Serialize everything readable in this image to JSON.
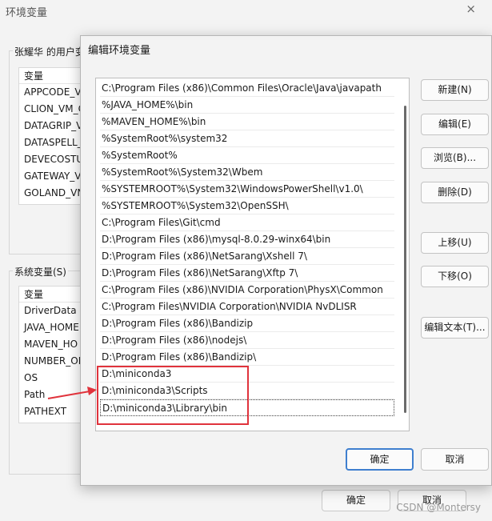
{
  "background_window": {
    "title": "环境变量",
    "close_glyph": "×",
    "user_group_label": "张耀华 的用户变",
    "user_vars_header": "变量",
    "user_vars": [
      "APPCODE_VI",
      "CLION_VM_C",
      "DATAGRIP_V",
      "DATASPELL_",
      "DEVECOSTU",
      "GATEWAY_V",
      "GOLAND_VN"
    ],
    "system_group_label": "系统变量(S)",
    "system_vars_header": "变量",
    "system_vars": [
      "DriverData",
      "JAVA_HOME",
      "MAVEN_HO",
      "NUMBER_OI",
      "OS",
      "Path",
      "PATHEXT"
    ],
    "ok_label": "确定",
    "cancel_label": "取消"
  },
  "dialog": {
    "title": "编辑环境变量",
    "paths": [
      "C:\\Program Files (x86)\\Common Files\\Oracle\\Java\\javapath",
      "%JAVA_HOME%\\bin",
      "%MAVEN_HOME%\\bin",
      "%SystemRoot%\\system32",
      "%SystemRoot%",
      "%SystemRoot%\\System32\\Wbem",
      "%SYSTEMROOT%\\System32\\WindowsPowerShell\\v1.0\\",
      "%SYSTEMROOT%\\System32\\OpenSSH\\",
      "C:\\Program Files\\Git\\cmd",
      "D:\\Program Files (x86)\\mysql-8.0.29-winx64\\bin",
      "D:\\Program Files (x86)\\NetSarang\\Xshell 7\\",
      "D:\\Program Files (x86)\\NetSarang\\Xftp 7\\",
      "C:\\Program Files (x86)\\NVIDIA Corporation\\PhysX\\Common",
      "C:\\Program Files\\NVIDIA Corporation\\NVIDIA NvDLISR",
      "D:\\Program Files (x86)\\Bandizip",
      "D:\\Program Files (x86)\\nodejs\\",
      "D:\\Program Files (x86)\\Bandizip\\",
      "D:\\miniconda3",
      "D:\\miniconda3\\Scripts",
      "D:\\miniconda3\\Library\\bin"
    ],
    "buttons": {
      "new": "新建(N)",
      "edit": "编辑(E)",
      "browse": "浏览(B)...",
      "delete": "删除(D)",
      "move_up": "上移(U)",
      "move_down": "下移(O)",
      "edit_text": "编辑文本(T)..."
    },
    "ok_label": "确定",
    "cancel_label": "取消"
  },
  "watermark": "CSDN @Montersy",
  "colors": {
    "annotation": "#e0333c",
    "focus": "#3f7fcf"
  }
}
